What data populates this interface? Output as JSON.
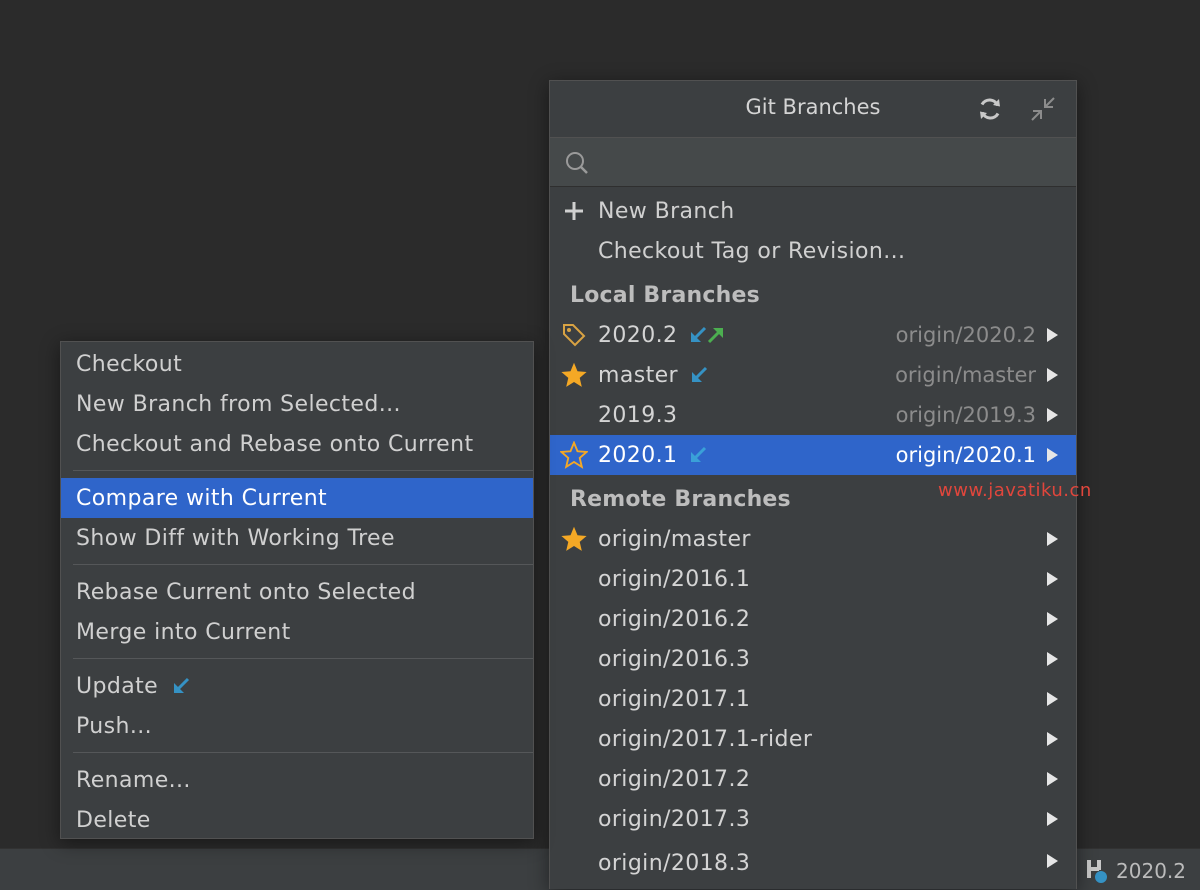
{
  "popup": {
    "title": "Git Branches",
    "refresh_icon": "refresh-icon",
    "collapse_icon": "collapse-icon",
    "search": {
      "placeholder": "",
      "value": ""
    },
    "actions": [
      {
        "label": "New Branch",
        "icon": "plus-icon"
      },
      {
        "label": "Checkout Tag or Revision...",
        "icon": ""
      }
    ],
    "local_header": "Local Branches",
    "local_branches": [
      {
        "name": "2020.2",
        "tracking": "origin/2020.2",
        "icon": "tag-icon",
        "marks": [
          "incoming-arrow-icon",
          "outgoing-arrow-icon"
        ],
        "selected": false
      },
      {
        "name": "master",
        "tracking": "origin/master",
        "icon": "favorite-star-icon",
        "marks": [
          "incoming-arrow-icon"
        ],
        "selected": false
      },
      {
        "name": "2019.3",
        "tracking": "origin/2019.3",
        "icon": "",
        "marks": [],
        "selected": false
      },
      {
        "name": "2020.1",
        "tracking": "origin/2020.1",
        "icon": "star-outline-icon",
        "marks": [
          "incoming-arrow-icon"
        ],
        "selected": true
      }
    ],
    "remote_header": "Remote Branches",
    "remote_branches": [
      {
        "name": "origin/master",
        "icon": "favorite-star-icon"
      },
      {
        "name": "origin/2016.1",
        "icon": ""
      },
      {
        "name": "origin/2016.2",
        "icon": ""
      },
      {
        "name": "origin/2016.3",
        "icon": ""
      },
      {
        "name": "origin/2017.1",
        "icon": ""
      },
      {
        "name": "origin/2017.1-rider",
        "icon": ""
      },
      {
        "name": "origin/2017.2",
        "icon": ""
      },
      {
        "name": "origin/2017.3",
        "icon": ""
      },
      {
        "name": "origin/2018.3",
        "icon": ""
      }
    ]
  },
  "context_menu": {
    "groups": [
      [
        "Checkout",
        "New Branch from Selected...",
        "Checkout and Rebase onto Current"
      ],
      [
        "Compare with Current",
        "Show Diff with Working Tree"
      ],
      [
        "Rebase Current onto Selected",
        "Merge into Current"
      ],
      [
        "Update",
        "Push..."
      ],
      [
        "Rename...",
        "Delete"
      ]
    ],
    "selected": "Compare with Current",
    "update_icon": "incoming-arrow-icon"
  },
  "statusbar": {
    "branch_label": "2020.2",
    "branch_icon": "git-branch-icon"
  },
  "watermark": "www.javatiku.cn",
  "colors": {
    "background": "#2b2b2b",
    "panel": "#3c3f41",
    "selection": "#2f65ca",
    "incoming": "#3592c4",
    "outgoing": "#4caf50",
    "star": "#f4a825",
    "tag": "#d9a343",
    "watermark": "#e0463c"
  }
}
